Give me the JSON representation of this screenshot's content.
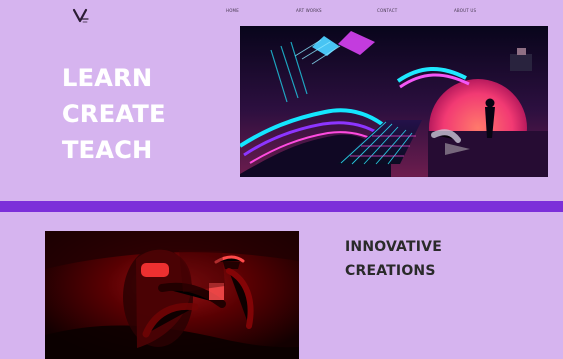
{
  "brand": {
    "logo_text": "V",
    "logo_icon": "logo-v-icon"
  },
  "nav": {
    "items": [
      {
        "label": "HOME"
      },
      {
        "label": "ART WORKS"
      },
      {
        "label": "CONTACT"
      },
      {
        "label": "ABOUT US"
      }
    ]
  },
  "hero": {
    "lines": [
      "LEARN",
      "CREATE",
      "TEACH"
    ],
    "image_alt": "Neon VR game world"
  },
  "section": {
    "title_lines": [
      "INNOVATIVE",
      "CREATIONS"
    ],
    "image_alt": "Person wearing VR headset in red light"
  },
  "colors": {
    "background": "#d6b4ef",
    "divider": "#7c2fd9",
    "hero_text": "#ffffff",
    "section_title": "#2a2a2a"
  }
}
